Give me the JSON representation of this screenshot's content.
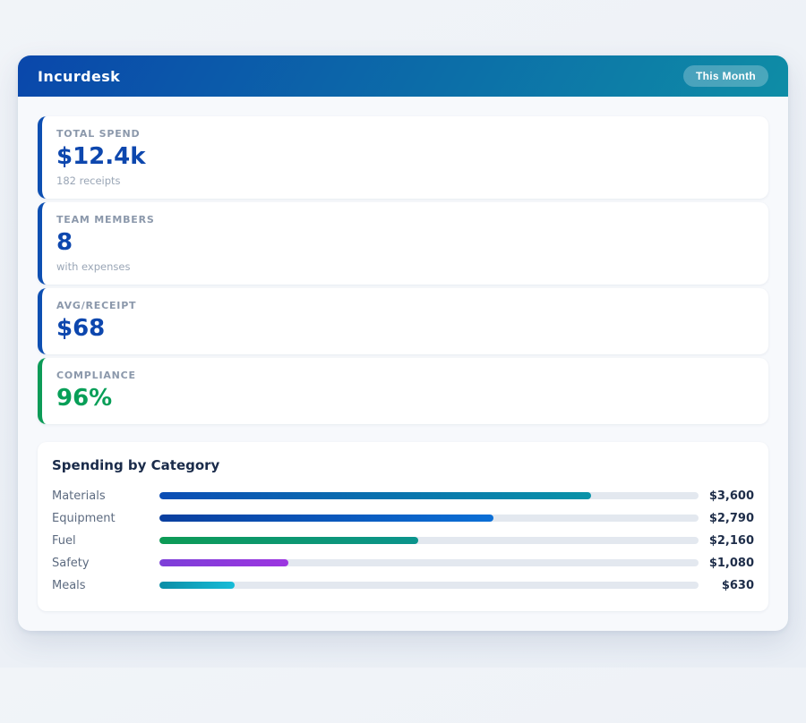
{
  "header": {
    "title": "Incurdesk",
    "period_badge": "This Month",
    "gradient_from": "#0a47ab",
    "gradient_to": "#0e8da6"
  },
  "stats": [
    {
      "label": "TOTAL SPEND",
      "value": "$12.4k",
      "sub": "182 receipts",
      "accent": "#0d4fb2",
      "value_color": "#0d47ae"
    },
    {
      "label": "TEAM MEMBERS",
      "value": "8",
      "sub": "with expenses",
      "accent": "#0d4fb2",
      "value_color": "#0d47ae"
    },
    {
      "label": "AVG/RECEIPT",
      "value": "$68",
      "sub": "",
      "accent": "#0d4fb2",
      "value_color": "#0d47ae"
    },
    {
      "label": "COMPLIANCE",
      "value": "96%",
      "sub": "",
      "accent": "#0c9b57",
      "value_color": "#089f58"
    }
  ],
  "chart_data": {
    "type": "bar",
    "orientation": "horizontal",
    "title": "Spending by Category",
    "categories": [
      "Materials",
      "Equipment",
      "Fuel",
      "Safety",
      "Meals"
    ],
    "values": [
      3600,
      2790,
      2160,
      1080,
      630
    ],
    "value_labels": [
      "$3,600",
      "$2,790",
      "$2,160",
      "$1,080",
      "$630"
    ],
    "scale_max": 4500,
    "track_color": "#e3e8ef",
    "bar_gradients": [
      [
        "#0b4db5",
        "#0a93a8"
      ],
      [
        "#0a3f9f",
        "#0b6fd6"
      ],
      [
        "#0d9b55",
        "#0b948d"
      ],
      [
        "#7d3fd8",
        "#9c35e0"
      ],
      [
        "#0a8ea6",
        "#17bcd8"
      ]
    ]
  }
}
